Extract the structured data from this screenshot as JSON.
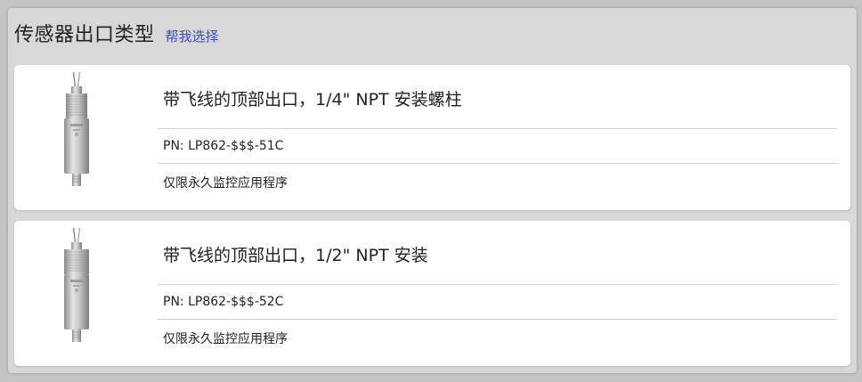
{
  "header": {
    "title": "传感器出口类型",
    "help_link": "帮我选择"
  },
  "cards": [
    {
      "title": "带飞线的顶部出口，1/4\" NPT 安装螺柱",
      "part_number": "PN: LP862-$$$-51C",
      "note": "仅限永久监控应用程序",
      "image_icon": "sensor-image"
    },
    {
      "title": "带飞线的顶部出口，1/2\" NPT 安装",
      "part_number": "PN: LP862-$$$-52C",
      "note": "仅限永久监控应用程序",
      "image_icon": "sensor-image"
    }
  ],
  "colors": {
    "link": "#3a4fb5",
    "panel": "#d8d8d8",
    "card": "#ffffff"
  }
}
